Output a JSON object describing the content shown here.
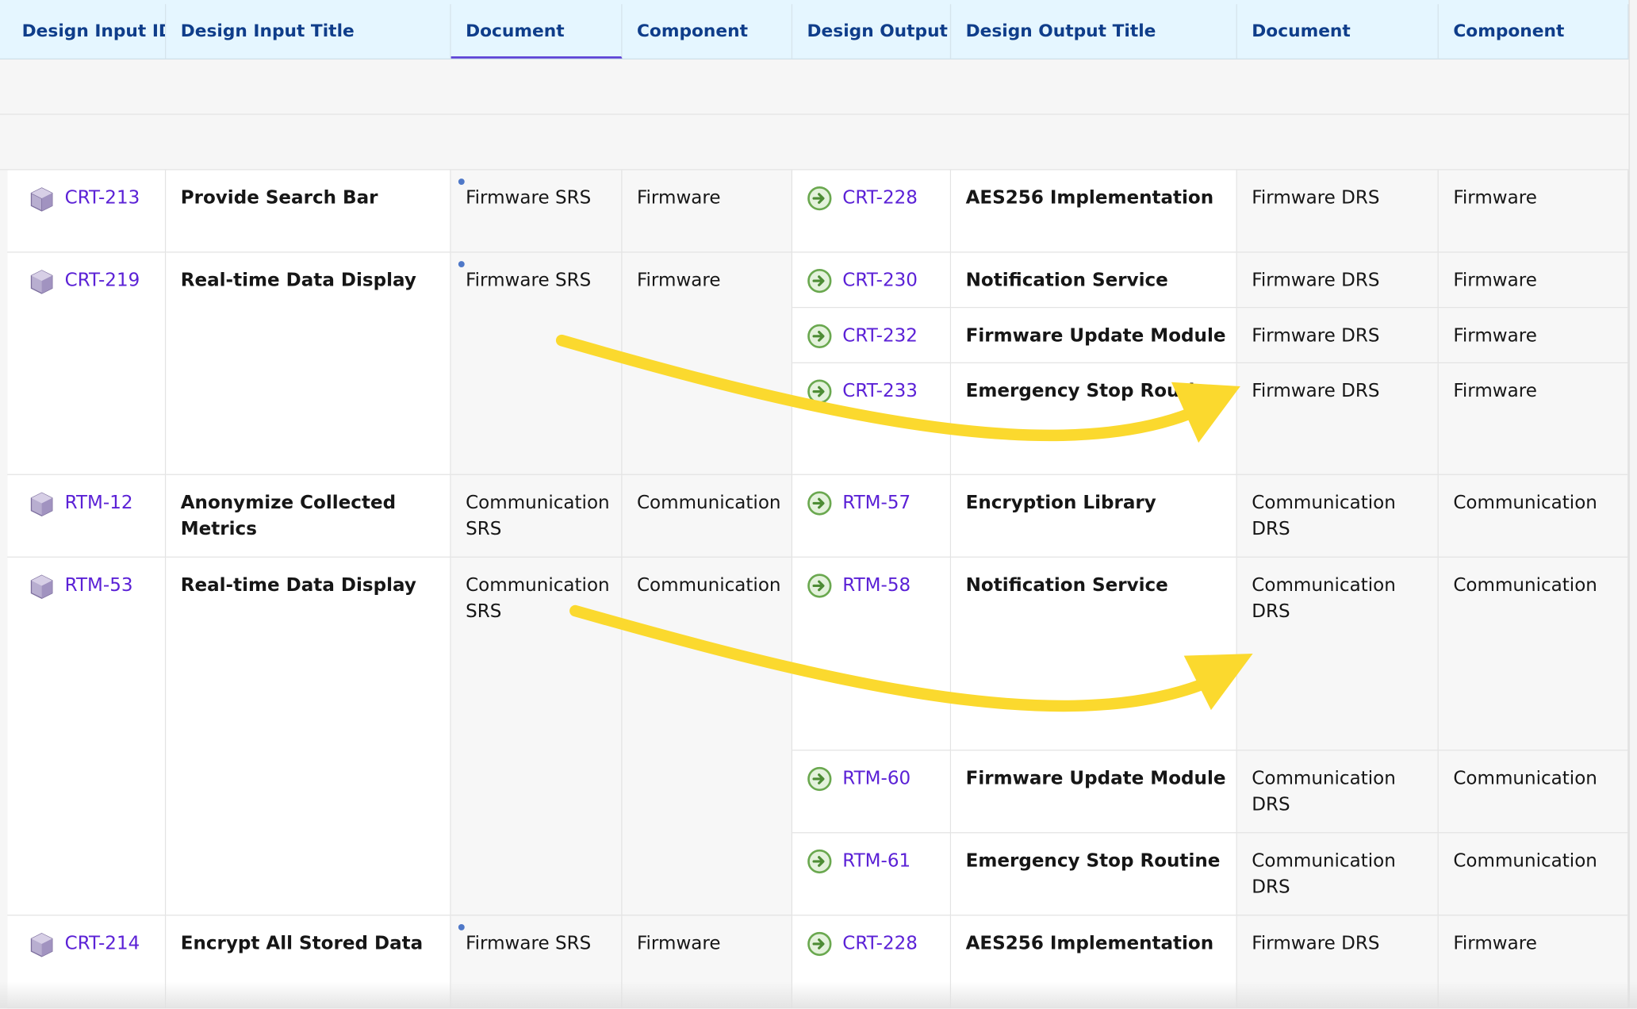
{
  "header": {
    "design_input_id": "Design Input ID",
    "design_input_title": "Design Input Title",
    "input_document": "Document",
    "input_component": "Component",
    "design_output_id": "Design Output ID",
    "design_output_title": "Design Output Title",
    "output_document": "Document",
    "output_component": "Component"
  },
  "inputs": [
    {
      "id": "CRT-213",
      "title": "Provide Search Bar",
      "document": "Firmware SRS",
      "component": "Firmware"
    },
    {
      "id": "CRT-219",
      "title": "Real-time Data Display",
      "document": "Firmware SRS",
      "component": "Firmware"
    },
    {
      "id": "RTM-12",
      "title": "Anonymize Collected",
      "title2": "Metrics",
      "document": "Communication",
      "document2": "SRS",
      "component": "Communication"
    },
    {
      "id": "RTM-53",
      "title": "Real-time Data Display",
      "document": "Communication",
      "document2": "SRS",
      "component": "Communication"
    },
    {
      "id": "CRT-214",
      "title": "Encrypt All Stored Data",
      "document": "Firmware SRS",
      "component": "Firmware"
    }
  ],
  "outputs": [
    {
      "id": "CRT-228",
      "title": "AES256 Implementation",
      "document": "Firmware DRS",
      "component": "Firmware"
    },
    {
      "id": "CRT-230",
      "title": "Notification Service",
      "document": "Firmware DRS",
      "component": "Firmware"
    },
    {
      "id": "CRT-232",
      "title": "Firmware Update Module",
      "document": "Firmware DRS",
      "component": "Firmware"
    },
    {
      "id": "CRT-233",
      "title": "Emergency Stop Routine",
      "document": "Firmware DRS",
      "component": "Firmware"
    },
    {
      "id": "RTM-57",
      "title": "Encryption Library",
      "document": "Communication",
      "document2": "DRS",
      "component": "Communication"
    },
    {
      "id": "RTM-58",
      "title": "Notification Service",
      "document": "Communication",
      "document2": "DRS",
      "component": "Communication"
    },
    {
      "id": "RTM-60",
      "title": "Firmware Update Module",
      "document": "Communication",
      "document2": "DRS",
      "component": "Communication"
    },
    {
      "id": "RTM-61",
      "title": "Emergency Stop Routine",
      "document": "Communication",
      "document2": "DRS",
      "component": "Communication"
    },
    {
      "id": "CRT-228",
      "title": "AES256 Implementation",
      "document": "Firmware DRS",
      "component": "Firmware"
    }
  ],
  "icons": {
    "input_item": "cube-icon",
    "output_item": "arrow-circle-icon",
    "annotation": "yellow-curved-arrow"
  },
  "colors": {
    "header_bg": "#e5f6ff",
    "header_text": "#0f3d8a",
    "link": "#5b21d6",
    "annotation_arrow": "#fbd92e",
    "output_icon": "#6aa84f",
    "input_icon": "#9a8bb8"
  }
}
